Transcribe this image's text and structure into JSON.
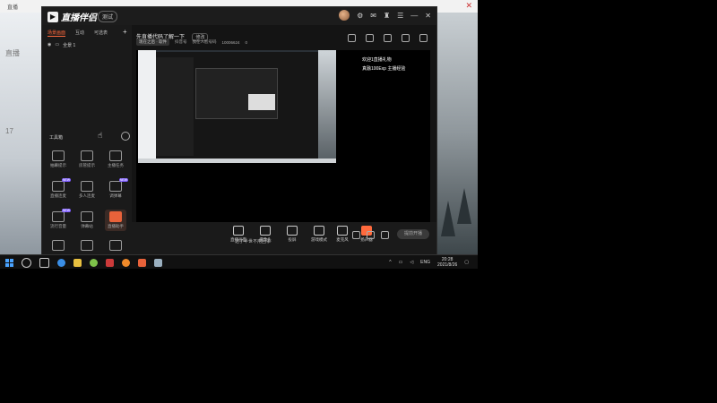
{
  "desktop": {
    "window_title": "直播",
    "close_glyph": "✕",
    "bg_caption_1": "直播",
    "bg_caption_2": "17"
  },
  "app": {
    "logo_text": "直播伴侣",
    "version_badge": "测试",
    "tabs": [
      "场景画面",
      "互动",
      "可选表"
    ],
    "scene_item": "全景 1",
    "toolbox_title": "工具箱",
    "tools": [
      {
        "label": "抽幕提示",
        "new": false
      },
      {
        "label": "房管提示",
        "new": false
      },
      {
        "label": "主播任务",
        "new": false
      },
      {
        "label": "直播连麦",
        "new": true
      },
      {
        "label": "多人连麦",
        "new": false
      },
      {
        "label": "调弹幕",
        "new": true
      },
      {
        "label": "流行音量",
        "new": true
      },
      {
        "label": "弹幕站",
        "new": false
      },
      {
        "label": "直播助手",
        "new": false
      },
      {
        "label": "",
        "new": false
      },
      {
        "label": "",
        "new": false
      },
      {
        "label": "",
        "new": false
      }
    ],
    "stream": {
      "title": "先直播代码了解一下",
      "edit_label": "修改",
      "category": "现在之后 · 软件",
      "viewers_text": "抖音号",
      "id_label": "我在人脸号码",
      "id_value": "10006624",
      "likes": "0"
    },
    "overlay_lines": [
      "欢迎1直播礼物",
      "真融100Exp 主播经验"
    ],
    "bottom_bar": [
      {
        "label": "直播画面"
      },
      {
        "label": "摄像头"
      },
      {
        "label": "投屏"
      },
      {
        "label": "游戏模式"
      },
      {
        "label": "麦克风"
      },
      {
        "label": "扬声器"
      }
    ],
    "go_live_label": "提前开播",
    "subtitle": "这了半世不用回事"
  },
  "taskbar": {
    "lang": "ENG",
    "time": "20:28",
    "date": "2021/8/26"
  },
  "colors": {
    "accent": "#ff6a3d",
    "purple_badge": "#7d5cff"
  }
}
